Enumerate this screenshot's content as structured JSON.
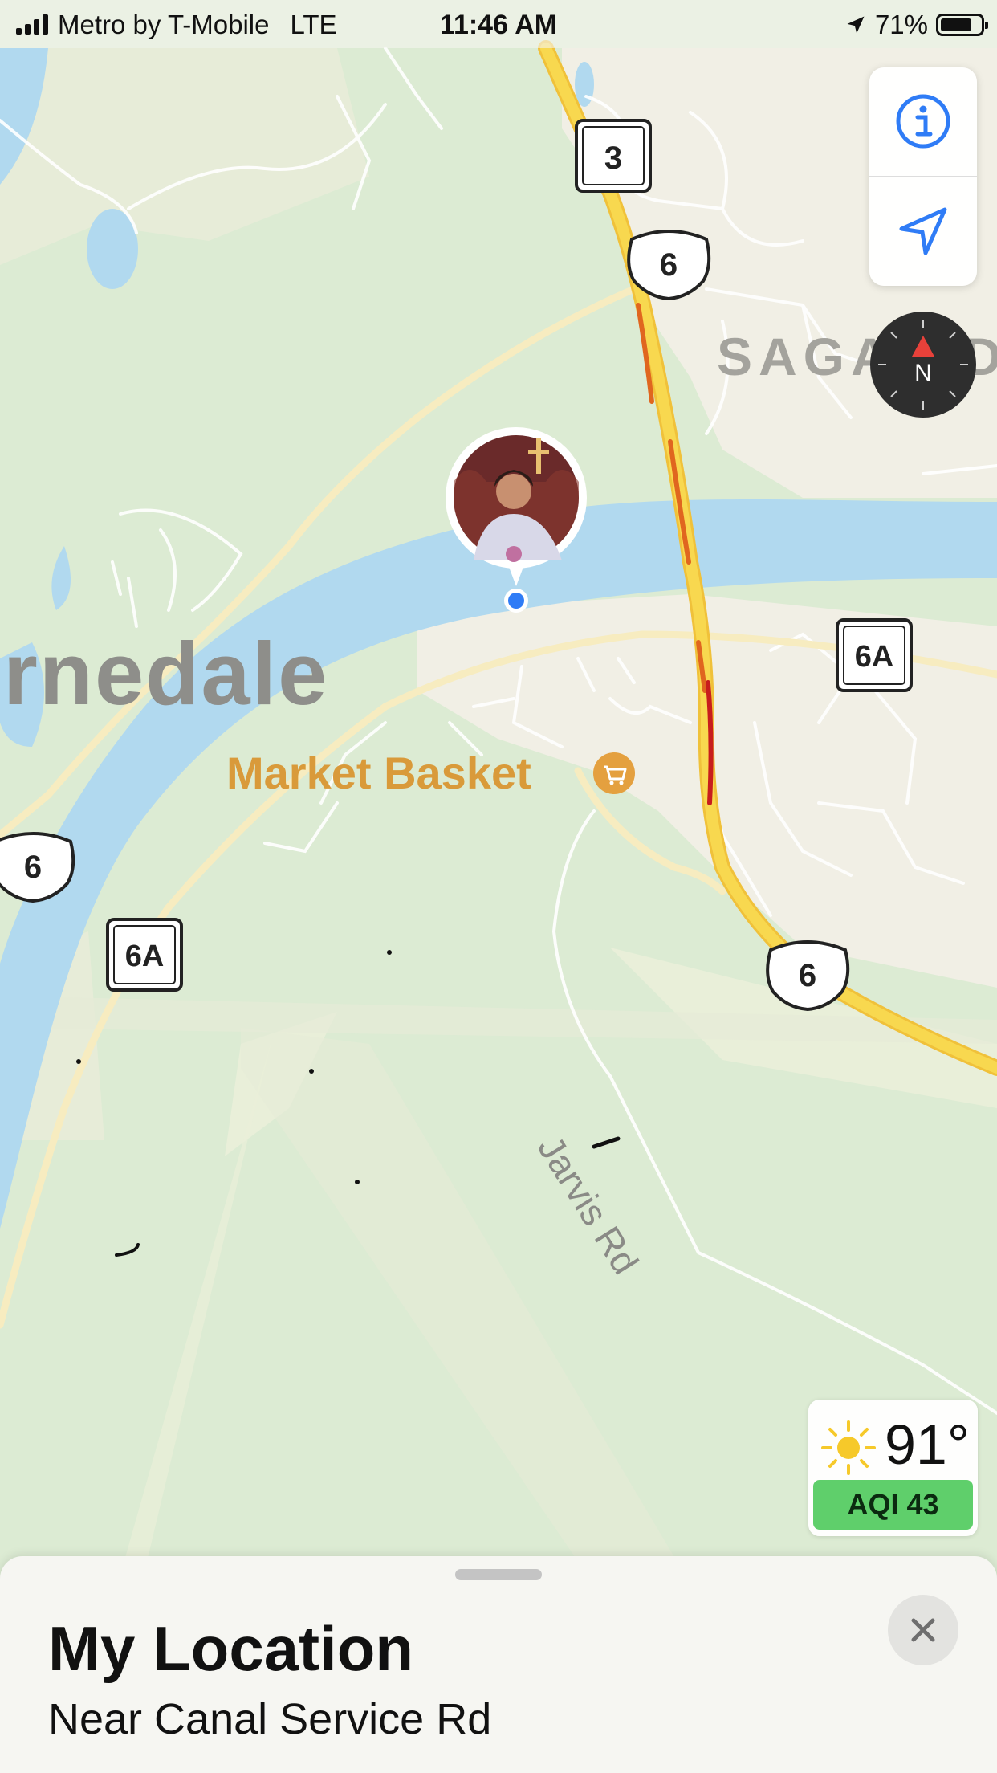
{
  "status_bar": {
    "carrier": "Metro by T-Mobile",
    "network": "LTE",
    "time": "11:46 AM",
    "battery": "71%"
  },
  "map": {
    "place_labels": {
      "town": "rnedale",
      "neighborhood": "SAGA",
      "neighborhood_tail": "D",
      "poi": "Market Basket",
      "road": "Jarvis Rd"
    },
    "route_shields": [
      "3",
      "6",
      "6A",
      "6",
      "6A",
      "6"
    ]
  },
  "controls": {
    "info_icon": "info-icon",
    "location_icon": "location-arrow-icon",
    "compass_label": "N"
  },
  "weather": {
    "temperature": "91°",
    "aqi": "AQI 43"
  },
  "sheet": {
    "title": "My Location",
    "subtitle": "Near Canal Service Rd"
  },
  "colors": {
    "land": "#dcebd3",
    "water": "#b1d9ef",
    "highway": "#f7d24d",
    "traffic": "#e0661f",
    "poi": "#d99a3a",
    "aqi_good": "#5fcf6b",
    "user_dot": "#2f7cf6"
  }
}
